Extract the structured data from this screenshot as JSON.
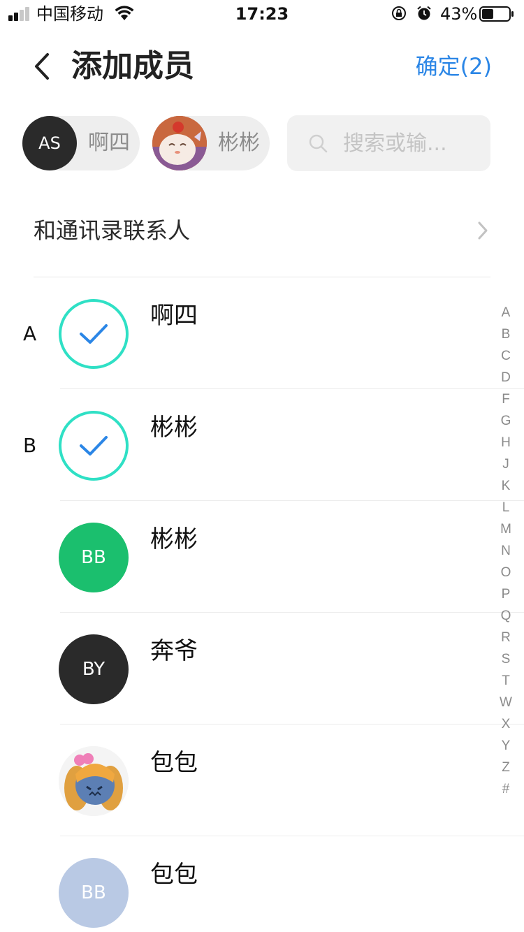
{
  "status_bar": {
    "carrier": "中国移动",
    "time": "17:23",
    "battery_percent": "43%",
    "battery_level": 0.43,
    "icons": [
      "signal-icon",
      "wifi-icon",
      "rotation-lock-icon",
      "alarm-icon",
      "battery-icon"
    ]
  },
  "nav": {
    "back_icon": "chevron-left-icon",
    "title": "添加成员",
    "confirm_label": "确定(2)",
    "accent_color": "#2b86e6"
  },
  "selected": [
    {
      "initials": "AS",
      "name": "啊四",
      "avatar_color": "#2a2a2a"
    },
    {
      "name": "彬彬",
      "avatar": "photo-avatar"
    }
  ],
  "search": {
    "placeholder": "搜索或输..."
  },
  "address_book": {
    "label": "和通讯录联系人"
  },
  "contacts": [
    {
      "section": "A",
      "name": "啊四",
      "selected": true
    },
    {
      "section": "B",
      "name": "彬彬",
      "selected": true
    },
    {
      "section": "",
      "name": "彬彬",
      "initials": "BB",
      "avatar_color": "#1bbf6e",
      "selected": false
    },
    {
      "section": "",
      "name": "奔爷",
      "initials": "BY",
      "avatar_color": "#2a2a2a",
      "selected": false
    },
    {
      "section": "",
      "name": "包包",
      "avatar": "photo-avatar",
      "selected": false
    },
    {
      "section": "",
      "name": "包包",
      "initials": "BB",
      "avatar_color": "#b9c9e4",
      "selected": false
    }
  ],
  "check_ring_color": "#2fe0c5",
  "index_letters": [
    "A",
    "B",
    "C",
    "D",
    "F",
    "G",
    "H",
    "J",
    "K",
    "L",
    "M",
    "N",
    "O",
    "P",
    "Q",
    "R",
    "S",
    "T",
    "W",
    "X",
    "Y",
    "Z",
    "#"
  ]
}
